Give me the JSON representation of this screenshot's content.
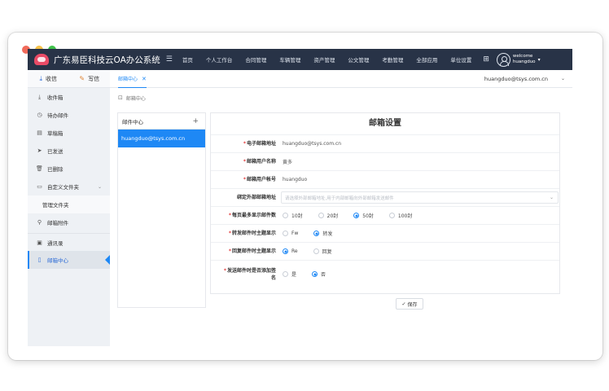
{
  "app": {
    "title": "广东易臣科技云OA办公系统",
    "menu_toggle_icon": "menu-icon"
  },
  "topnav": [
    "首页",
    "个人工作台",
    "合同管理",
    "车辆管理",
    "资产管理",
    "公文管理",
    "考勤管理",
    "全部应用",
    "单位设置"
  ],
  "user": {
    "welcome": "welcome",
    "name": "huangduo"
  },
  "sidebar": {
    "inbox": "收信",
    "compose": "写信",
    "items": [
      {
        "label": "收件箱",
        "icon": "download-icon"
      },
      {
        "label": "待办邮件",
        "icon": "clock-icon"
      },
      {
        "label": "草稿箱",
        "icon": "draft-icon"
      },
      {
        "label": "已发送",
        "icon": "send-icon"
      },
      {
        "label": "已删除",
        "icon": "trash-icon"
      },
      {
        "label": "自定义文件夹",
        "icon": "folder-icon"
      }
    ],
    "sub_item": "管理文件夹",
    "attachments": "邮箱附件",
    "contacts": "通讯录",
    "mail_center": "邮箱中心"
  },
  "tab": {
    "label": "邮箱中心"
  },
  "account_email": "huangduo@tsys.com.cn",
  "breadcrumb": "邮箱中心",
  "mailbox_panel": {
    "header": "邮件中心",
    "add": "+",
    "selected": "huangduo@tsys.com.cn"
  },
  "form": {
    "title": "邮箱设置",
    "email_label": "电子邮箱地址",
    "email_value": "huangduo@tsys.com.cn",
    "username_label": "邮箱用户名称",
    "username_value": "黄多",
    "account_label": "邮箱用户帐号",
    "account_value": "huangduo",
    "external_label": "绑定外部邮箱地址",
    "external_placeholder": "请选择外部邮箱地址,用于内部邮箱向外部邮箱发送邮件",
    "per_page_label": "每页最多显示邮件数",
    "per_page_options": [
      "10封",
      "20封",
      "50封",
      "100封"
    ],
    "per_page_selected": 2,
    "forward_label": "转发邮件时主题显示",
    "forward_options": [
      "Fw",
      "转发"
    ],
    "forward_selected": 1,
    "reply_label": "回复邮件时主题显示",
    "reply_options": [
      "Re",
      "回复"
    ],
    "reply_selected": 0,
    "sign_label_1": "发送邮件时是否添加签",
    "sign_label_2": "名",
    "sign_options": [
      "是",
      "否"
    ],
    "sign_selected": 1,
    "save": "保存"
  },
  "colors": {
    "topbar": "#283347",
    "accent": "#1e88f5",
    "required": "#e23c3c"
  }
}
